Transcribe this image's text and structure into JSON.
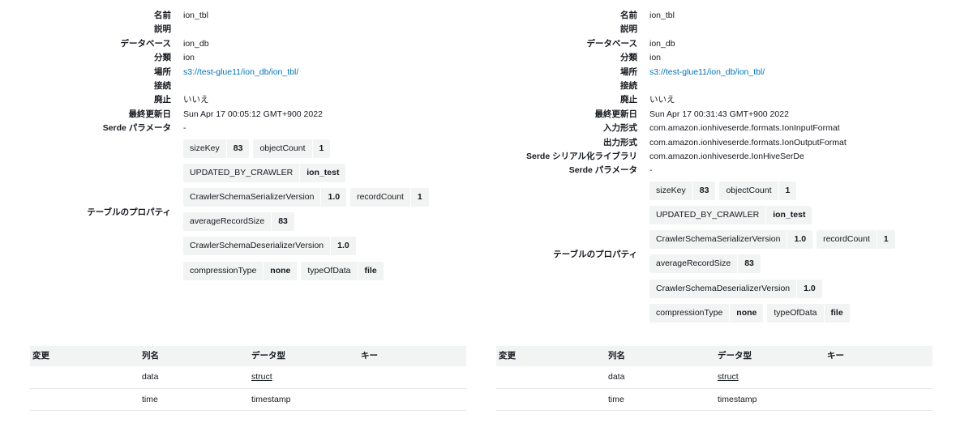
{
  "left": {
    "props": [
      {
        "label": "名前",
        "value": "ion_tbl"
      },
      {
        "label": "説明",
        "value": ""
      },
      {
        "label": "データベース",
        "value": "ion_db"
      },
      {
        "label": "分類",
        "value": "ion"
      },
      {
        "label": "場所",
        "value": "s3://test-glue11/ion_db/ion_tbl/",
        "link": true
      },
      {
        "label": "接続",
        "value": ""
      },
      {
        "label": "廃止",
        "value": "いいえ"
      },
      {
        "label": "最終更新日",
        "value": "Sun Apr 17 00:05:12 GMT+900 2022"
      },
      {
        "label": "Serde パラメータ",
        "value": "-"
      }
    ],
    "table_properties_label": "テーブルのプロパティ",
    "table_properties": [
      [
        {
          "key": "sizeKey",
          "value": "83"
        },
        {
          "key": "objectCount",
          "value": "1"
        }
      ],
      [
        {
          "key": "UPDATED_BY_CRAWLER",
          "value": "ion_test"
        }
      ],
      [
        {
          "key": "CrawlerSchemaSerializerVersion",
          "value": "1.0"
        },
        {
          "key": "recordCount",
          "value": "1"
        }
      ],
      [
        {
          "key": "averageRecordSize",
          "value": "83"
        }
      ],
      [
        {
          "key": "CrawlerSchemaDeserializerVersion",
          "value": "1.0"
        }
      ],
      [
        {
          "key": "compressionType",
          "value": "none"
        },
        {
          "key": "typeOfData",
          "value": "file"
        }
      ]
    ],
    "columns": {
      "headers": [
        "変更",
        "列名",
        "データ型",
        "キー"
      ],
      "rows": [
        {
          "change": "",
          "name": "data",
          "type": "struct",
          "type_link": true,
          "key": ""
        },
        {
          "change": "",
          "name": "time",
          "type": "timestamp",
          "type_link": false,
          "key": ""
        }
      ]
    }
  },
  "right": {
    "props": [
      {
        "label": "名前",
        "value": "ion_tbl"
      },
      {
        "label": "説明",
        "value": ""
      },
      {
        "label": "データベース",
        "value": "ion_db"
      },
      {
        "label": "分類",
        "value": "ion"
      },
      {
        "label": "場所",
        "value": "s3://test-glue11/ion_db/ion_tbl/",
        "link": true
      },
      {
        "label": "接続",
        "value": ""
      },
      {
        "label": "廃止",
        "value": "いいえ"
      },
      {
        "label": "最終更新日",
        "value": "Sun Apr 17 00:31:43 GMT+900 2022"
      },
      {
        "label": "入力形式",
        "value": "com.amazon.ionhiveserde.formats.IonInputFormat"
      },
      {
        "label": "出力形式",
        "value": "com.amazon.ionhiveserde.formats.IonOutputFormat"
      },
      {
        "label": "Serde シリアル化ライブラリ",
        "value": "com.amazon.ionhiveserde.IonHiveSerDe"
      },
      {
        "label": "Serde パラメータ",
        "value": "-"
      }
    ],
    "table_properties_label": "テーブルのプロパティ",
    "table_properties": [
      [
        {
          "key": "sizeKey",
          "value": "83"
        },
        {
          "key": "objectCount",
          "value": "1"
        }
      ],
      [
        {
          "key": "UPDATED_BY_CRAWLER",
          "value": "ion_test"
        }
      ],
      [
        {
          "key": "CrawlerSchemaSerializerVersion",
          "value": "1.0"
        },
        {
          "key": "recordCount",
          "value": "1"
        }
      ],
      [
        {
          "key": "averageRecordSize",
          "value": "83"
        }
      ],
      [
        {
          "key": "CrawlerSchemaDeserializerVersion",
          "value": "1.0"
        }
      ],
      [
        {
          "key": "compressionType",
          "value": "none"
        },
        {
          "key": "typeOfData",
          "value": "file"
        }
      ]
    ],
    "columns": {
      "headers": [
        "変更",
        "列名",
        "データ型",
        "キー"
      ],
      "rows": [
        {
          "change": "",
          "name": "data",
          "type": "struct",
          "type_link": true,
          "key": ""
        },
        {
          "change": "",
          "name": "time",
          "type": "timestamp",
          "type_link": false,
          "key": ""
        }
      ]
    }
  }
}
